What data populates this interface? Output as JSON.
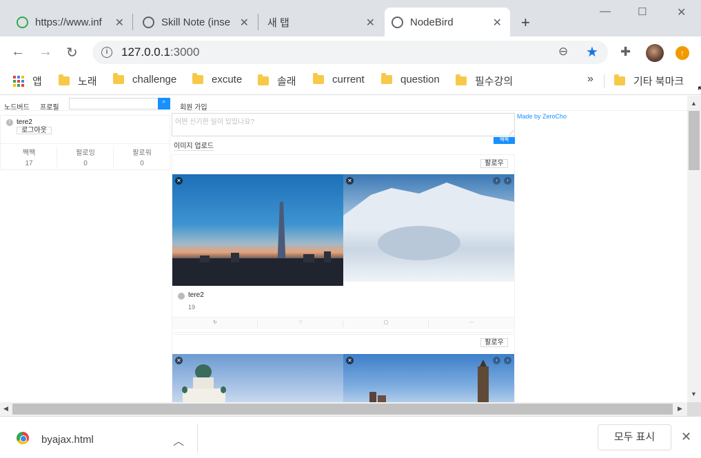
{
  "tabs": [
    {
      "title": "https://www.inf",
      "favicon_color": "#34a853"
    },
    {
      "title": "Skill Note (inse",
      "favicon_color": "#5f6368"
    },
    {
      "title": "새 탭",
      "favicon_color": ""
    },
    {
      "title": "NodeBird",
      "favicon_color": "#5f6368"
    }
  ],
  "toolbar": {
    "url_host": "127.0.0.1",
    "url_port": ":3000"
  },
  "bookmarks": {
    "apps_label": "앱",
    "items": [
      "노래",
      "challenge",
      "excute",
      "솔래",
      "current",
      "question",
      "필수강의"
    ],
    "more": "»",
    "other": "기타 북마크"
  },
  "app": {
    "menu": [
      "노드버드",
      "프로필"
    ],
    "signup": "회원 가입",
    "made_by": "Made by ZeroCho",
    "user": {
      "avatar_letter": "t",
      "name": "tere2",
      "logout": "로그아웃",
      "stats": [
        {
          "label": "짹짹",
          "value": "17"
        },
        {
          "label": "팔로잉",
          "value": "0"
        },
        {
          "label": "팔로워",
          "value": "0"
        }
      ]
    },
    "post_form": {
      "placeholder": "어떤 신기한 일이 있었나요?",
      "upload": "이미지 업로드",
      "submit": "짹짹"
    },
    "posts": [
      {
        "follow": "팔로우",
        "author": "tere2",
        "content": "19"
      },
      {
        "follow": "팔로우"
      }
    ]
  },
  "downloads": {
    "file": "byajax.html",
    "show_all": "모두 표시"
  }
}
